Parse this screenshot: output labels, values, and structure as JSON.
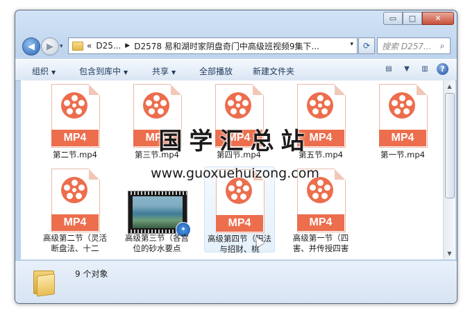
{
  "window": {
    "min_glyph": "▭",
    "max_glyph": "□",
    "close_glyph": "✕"
  },
  "nav": {
    "back_glyph": "◀",
    "forward_glyph": "▶",
    "drop_glyph": "▾",
    "address": {
      "overflow": "«",
      "seg1": "D25...",
      "sep": "▶",
      "seg2": "D2578 易和湖时家阴盘奇门中高级班视频9集下...",
      "drop": "▾"
    },
    "refresh_glyph": "⟳",
    "search_placeholder": "搜索 D257...",
    "search_icon": "⌕"
  },
  "toolbar": {
    "organize": "组织",
    "include_library": "包含到库中",
    "share": "共享",
    "play_all": "全部播放",
    "new_folder": "新建文件夹",
    "arrow": "▼",
    "view_glyph": "▤",
    "view_arrow": "▼",
    "pane_glyph": "▥",
    "help_glyph": "?"
  },
  "files": [
    {
      "name": "第二节.mp4",
      "type_label": "MP4"
    },
    {
      "name": "第三节.mp4",
      "type_label": "MP4"
    },
    {
      "name": "第四节.mp4",
      "type_label": "MP4"
    },
    {
      "name": "第五节.mp4",
      "type_label": "MP4"
    },
    {
      "name": "第一节.mp4",
      "type_label": "MP4"
    },
    {
      "name": "高级第二节（灵活断盘法、十二",
      "type_label": "MP4"
    },
    {
      "name": "高级第三节（各宫位的砂水要点",
      "type_label": ""
    },
    {
      "name": "高级第四节（阳法与招财、桃",
      "type_label": "MP4"
    },
    {
      "name": "高级第一节（四害、并传授四害",
      "type_label": "MP4"
    }
  ],
  "video_thumb": {
    "badge_glyph": "✦"
  },
  "scrollbar": {
    "up": "▲",
    "down": "▼"
  },
  "status": {
    "count": "9 个对象"
  },
  "watermark": {
    "title": "国学汇总站",
    "url": "www.guoxuehuizong.com"
  }
}
